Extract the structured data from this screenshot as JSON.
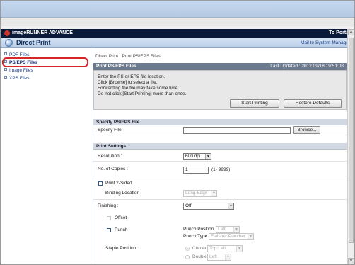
{
  "header": {
    "product": "imageRUNNER ADVANCE",
    "to_portal": "To Portal",
    "page_title": "Direct Print",
    "mail_link": "Mail to System Manager"
  },
  "sidebar": {
    "items": [
      {
        "label": "PDF Files"
      },
      {
        "label": "PS/EPS Files"
      },
      {
        "label": "Image Files"
      },
      {
        "label": "XPS Files"
      }
    ]
  },
  "breadcrumb": "Direct Print : Print PS/EPS Files",
  "panel": {
    "title": "Print PS/EPS Files",
    "last_updated": "Last Updated : 2012 09/18 19:51:08",
    "instructions": [
      "Enter the PS or EPS file location.",
      "Click [Browse] to select a file.",
      "Forwarding the file may take some time.",
      "Do not click [Start Printing] more than once."
    ],
    "start_button": "Start Printing",
    "restore_button": "Restore Defaults"
  },
  "specify": {
    "section_title": "Specify PS/EPS File",
    "file_label": "Specify File",
    "file_value": "",
    "browse_button": "Browse..."
  },
  "settings": {
    "section_title": "Print Settings",
    "resolution_label": "Resolution :",
    "resolution_value": "600 dpi",
    "copies_label": "No. of Copies :",
    "copies_value": "1",
    "copies_range": "(1- 9999)",
    "two_sided_label": "Print 2-Sided",
    "binding_label": "Binding Location",
    "binding_value": "Long Edge",
    "finishing_label": "Finishing :",
    "finishing_value": "Off",
    "offset_label": "Offset",
    "punch_label": "Punch",
    "punch_position_label": "Punch Position",
    "punch_position_value": "Left",
    "punch_type_label": "Punch Type",
    "punch_type_value": "Finisher Puncher",
    "staple_position_label": "Staple Position :",
    "corner_label": "Corner",
    "corner_value": "Top Left",
    "double_label": "Double",
    "double_value": "Left"
  }
}
